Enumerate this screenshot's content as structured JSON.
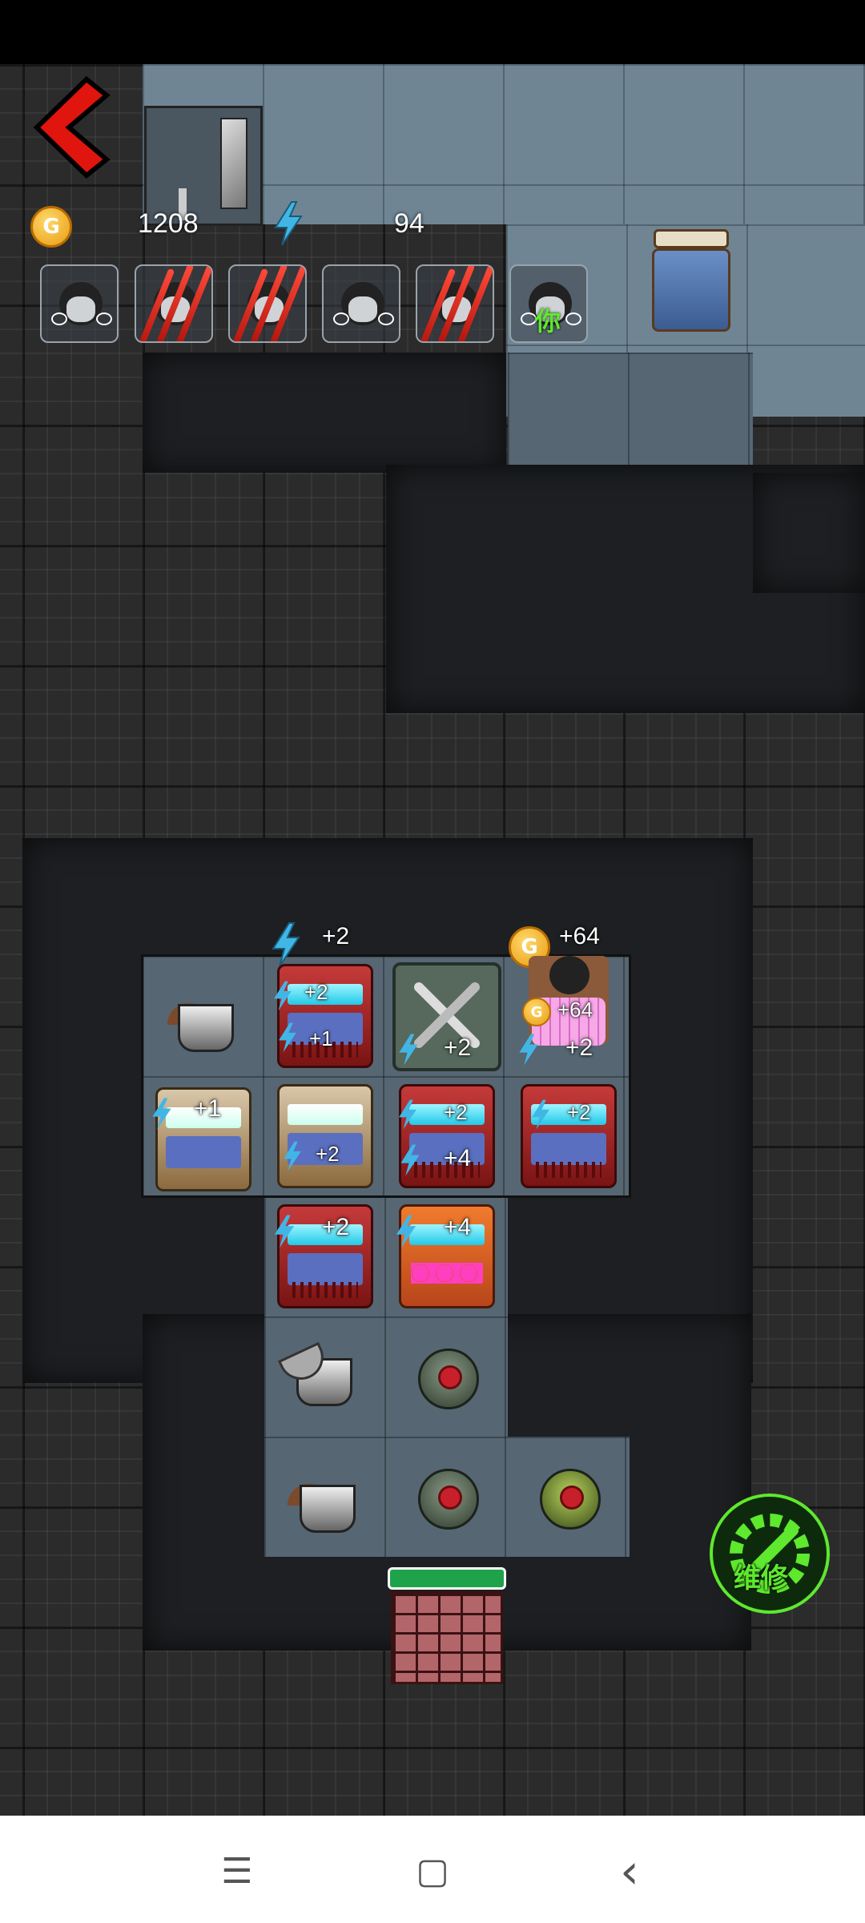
{
  "hud": {
    "gold_amount": "1208",
    "energy_amount": "94",
    "coin_letter": "G"
  },
  "players": [
    {
      "state": "alive"
    },
    {
      "state": "scratched"
    },
    {
      "state": "scratched"
    },
    {
      "state": "alive"
    },
    {
      "state": "scratched"
    },
    {
      "state": "alive",
      "label": "你"
    }
  ],
  "board": {
    "energy_float": "+2",
    "gold_float": "+64",
    "gold_small_float": "+64",
    "bed_bonus": "+2",
    "machines": [
      {
        "top": "+2",
        "bottom": "+1"
      },
      {
        "top": "+1",
        "bottom": "+2"
      },
      {
        "top": "+2",
        "bottom": "+4"
      },
      {
        "top": "+2"
      },
      {
        "top": "+2"
      },
      {
        "top": "+4"
      }
    ],
    "tool_bonus": "+2"
  },
  "repair_button": {
    "label": "维修"
  },
  "colors": {
    "accent_green": "#5ee82e",
    "back_red": "#e0150d",
    "door_green": "#1fa34a"
  },
  "nav": {
    "menu_icon": "☰",
    "home_icon": "▢",
    "back_icon": "‹"
  }
}
